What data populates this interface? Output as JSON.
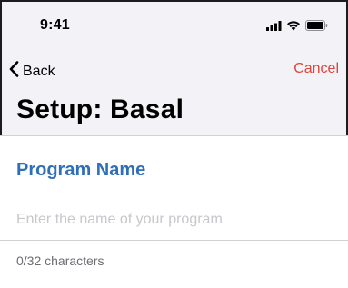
{
  "status_bar": {
    "time": "9:41",
    "icons": [
      "signal-icon",
      "wifi-icon",
      "battery-icon"
    ]
  },
  "nav": {
    "back_label": "Back",
    "cancel_label": "Cancel",
    "cancel_color": "#e0443a"
  },
  "page": {
    "title": "Setup: Basal"
  },
  "program": {
    "section_title": "Program Name",
    "section_title_color": "#2f6fb7",
    "input_value": "",
    "input_placeholder": "Enter the name of your program",
    "counter_text": "0/32 characters"
  }
}
